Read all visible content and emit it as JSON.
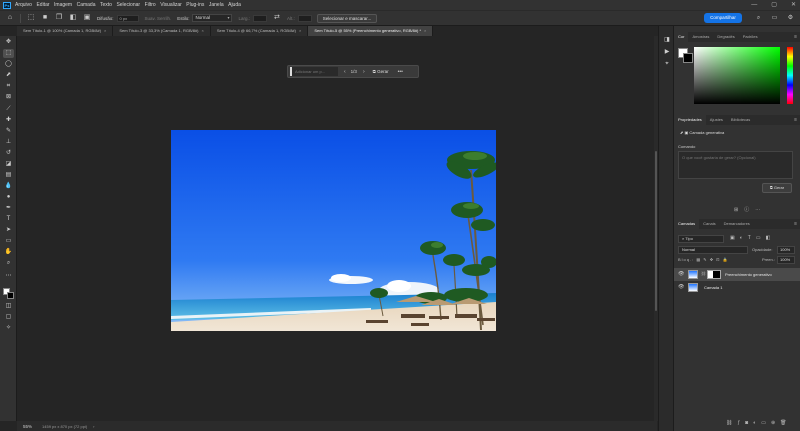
{
  "menubar": {
    "app_icon": "Ps",
    "items": [
      "Arquivo",
      "Editar",
      "Imagem",
      "Camada",
      "Texto",
      "Selecionar",
      "Filtro",
      "Visualizar",
      "Plug-ins",
      "Janela",
      "Ajuda"
    ],
    "window_controls": [
      "—",
      "▢",
      "✕"
    ]
  },
  "options": {
    "feather_label": "Difusão:",
    "feather_value": "0 px",
    "smooth_label": "Suav. Serrilh.",
    "style_label": "Estilo:",
    "style_value": "Normal",
    "width_label": "Larg.:",
    "height_label": "Alt.:",
    "select_mask_label": "Selecionar e mascarar...",
    "share_label": "Compartilhar"
  },
  "tabs": [
    {
      "label": "Sem Título-1 @ 100% (Camada 1, RGB/8#)",
      "active": false
    },
    {
      "label": "Sem Título-3 @ 33,3% (Camada 1, RGB/8#)",
      "active": false
    },
    {
      "label": "Sem Título-4 @ 66,7% (Camada 1, RGB/8#)",
      "active": false
    },
    {
      "label": "Sem Título-5 @ 55% (Preenchimento generativo, RGB/8#) *",
      "active": true
    }
  ],
  "context_bar": {
    "prompt_placeholder": "Adicionar um p...",
    "counter": "1/3",
    "generate_label": "Gerar",
    "more_label": "•••"
  },
  "status": {
    "zoom": "55%",
    "doc_info": "1459 px x 870 px (72 ppi)",
    "arrow": "›"
  },
  "color_panel": {
    "tabs": [
      "Cor",
      "Amostras",
      "Degradês",
      "Padrões"
    ],
    "accent": "#00ff00"
  },
  "properties_panel": {
    "tabs": [
      "Propriedades",
      "Ajustes",
      "Bibliotecas"
    ],
    "layer_type": "Camada generativa",
    "prompt_label": "Comando",
    "prompt_placeholder": "O que você gostaria de gerar? (Opcional)",
    "generate_label": "Gerar"
  },
  "layers_panel": {
    "tabs": [
      "Camadas",
      "Canais",
      "Demarcadores"
    ],
    "search_value": "Tipo",
    "blend_mode": "Normal",
    "opacity_label": "Opacidade:",
    "opacity_value": "100%",
    "lock_label": "Bloq.:",
    "fill_label": "Preen.:",
    "fill_value": "100%",
    "layers": [
      {
        "name": "Preenchimento generativo",
        "selected": true
      },
      {
        "name": "Camada 1",
        "selected": false
      }
    ]
  }
}
